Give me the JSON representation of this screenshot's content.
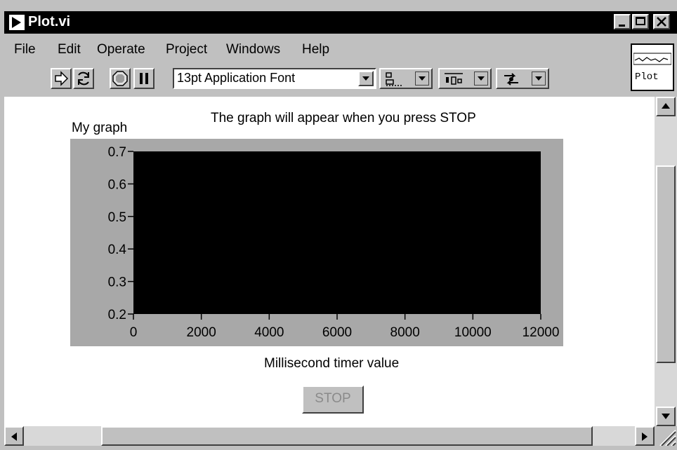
{
  "window": {
    "title": "Plot.vi"
  },
  "menu": [
    "File",
    "Edit",
    "Operate",
    "Project",
    "Windows",
    "Help"
  ],
  "toolbar": {
    "font": "13pt Application Font",
    "buttons": [
      "run-arrow-icon",
      "run-continuously-icon",
      "abort-icon",
      "pause-icon"
    ],
    "rings": [
      "align-objects-icon",
      "distribute-objects-icon",
      "reorder-icon"
    ]
  },
  "vi_icon": {
    "label": "Plot"
  },
  "panel": {
    "note": "The graph will appear when you press STOP",
    "graph_label": "My graph",
    "x_axis_label": "Millisecond timer value",
    "stop_label": "STOP"
  },
  "chart_data": {
    "type": "line",
    "title": "My graph",
    "xlabel": "Millisecond timer value",
    "ylabel": "",
    "x_ticks": [
      "0",
      "2000",
      "4000",
      "6000",
      "8000",
      "10000",
      "12000"
    ],
    "y_ticks": [
      "0.7",
      "0.6",
      "0.5",
      "0.4",
      "0.3",
      "0.2"
    ],
    "xlim": [
      0,
      12000
    ],
    "ylim": [
      0.2,
      0.7
    ],
    "series": [],
    "plot_background": "#000000"
  },
  "colors": {
    "title_bar": "#000000",
    "window_face": "#c0c0c0",
    "graph_frame": "#a8a8a8",
    "plot_area": "#000000"
  }
}
